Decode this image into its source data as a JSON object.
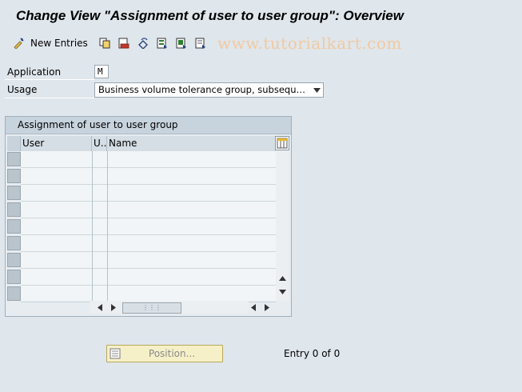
{
  "window": {
    "title": "Change View \"Assignment of user to user group\": Overview"
  },
  "toolbar": {
    "new_entries_label": "New Entries",
    "icons": [
      "new-entries-icon",
      "copy-icon",
      "delete-icon",
      "undo-icon",
      "select-all-icon",
      "select-block-icon",
      "deselect-all-icon"
    ]
  },
  "watermark": "www.tutorialkart.com",
  "form": {
    "application_label": "Application",
    "application_value": "M",
    "usage_label": "Usage",
    "usage_value": "Business volume tolerance group, subsequent s..."
  },
  "table": {
    "title": "Assignment of user to user group",
    "columns": [
      {
        "label": "User"
      },
      {
        "label": "U.."
      },
      {
        "label": "Name"
      }
    ],
    "rows": [
      {
        "user": "",
        "u": "",
        "name": ""
      },
      {
        "user": "",
        "u": "",
        "name": ""
      },
      {
        "user": "",
        "u": "",
        "name": ""
      },
      {
        "user": "",
        "u": "",
        "name": ""
      },
      {
        "user": "",
        "u": "",
        "name": ""
      },
      {
        "user": "",
        "u": "",
        "name": ""
      },
      {
        "user": "",
        "u": "",
        "name": ""
      },
      {
        "user": "",
        "u": "",
        "name": ""
      },
      {
        "user": "",
        "u": "",
        "name": ""
      }
    ]
  },
  "footer": {
    "position_button_label": "Position...",
    "entry_info": "Entry 0 of 0"
  },
  "colors": {
    "background": "#dfe6ec",
    "table_header": "#c7d3dd",
    "position_button": "#f6f0c8",
    "watermark": "#f2c9a0"
  }
}
